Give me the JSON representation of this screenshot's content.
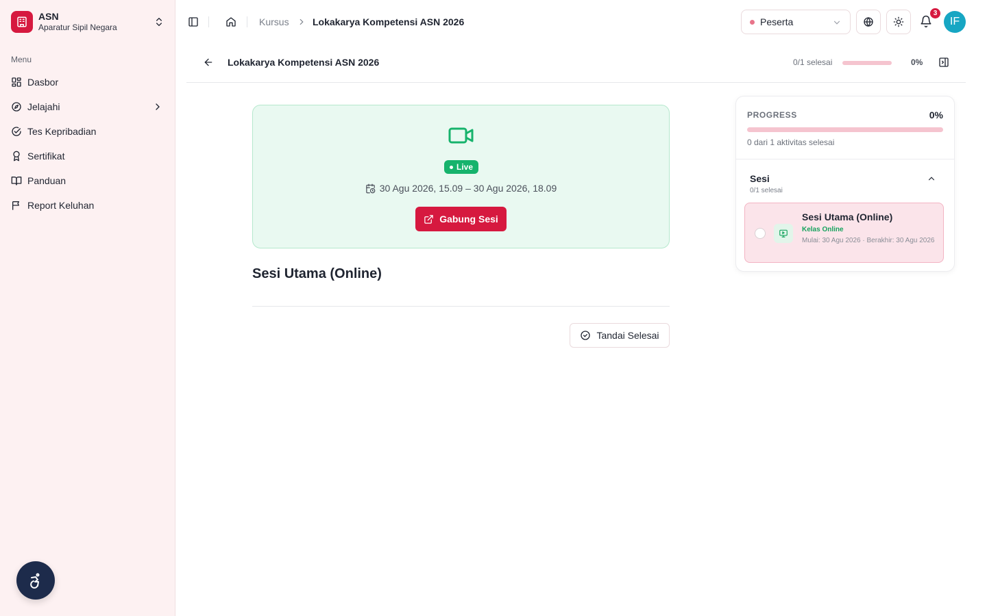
{
  "app": {
    "brand_name": "ASN",
    "brand_sub": "Aparatur Sipil Negara",
    "brand_color": "#d6193f"
  },
  "sidebar": {
    "menu_label": "Menu",
    "items": [
      {
        "label": "Dasbor",
        "icon": "grid-icon"
      },
      {
        "label": "Jelajahi",
        "icon": "compass-icon",
        "has_submenu": true
      },
      {
        "label": "Tes Kepribadian",
        "icon": "check-circle-icon"
      },
      {
        "label": "Sertifikat",
        "icon": "award-icon"
      },
      {
        "label": "Panduan",
        "icon": "book-open-icon"
      },
      {
        "label": "Report Keluhan",
        "icon": "flag-icon"
      }
    ]
  },
  "header": {
    "breadcrumb": [
      "Kursus",
      "Lokakarya Kompetensi ASN 2026"
    ],
    "role": "Peserta",
    "notification_count": "3",
    "avatar_initials": "IF"
  },
  "course": {
    "title": "Lokakarya Kompetensi ASN 2026",
    "progress_text": "0/1 selesai",
    "progress_fraction": 0,
    "progress_pct": "0%"
  },
  "session": {
    "status": "Live",
    "datetime": "30 Agu 2026, 15.09 – 30 Agu 2026, 18.09",
    "join_label": "Gabung Sesi",
    "heading": "Sesi Utama (Online)",
    "mark_done_label": "Tandai Selesai"
  },
  "progress_panel": {
    "label": "PROGRESS",
    "pct": "0%",
    "fraction": 0,
    "subtitle": "0 dari 1 aktivitas selesai",
    "section_title": "Sesi",
    "section_sub": "0/1 selesai",
    "activity": {
      "title": "Sesi Utama (Online)",
      "type": "Kelas Online",
      "dates": "Mulai: 30 Agu 2026 · Berakhir: 30 Agu 2026"
    }
  },
  "colors": {
    "accent": "#d6193f",
    "live_green": "#16b36c",
    "sidebar_bg": "#fdf1f2"
  }
}
